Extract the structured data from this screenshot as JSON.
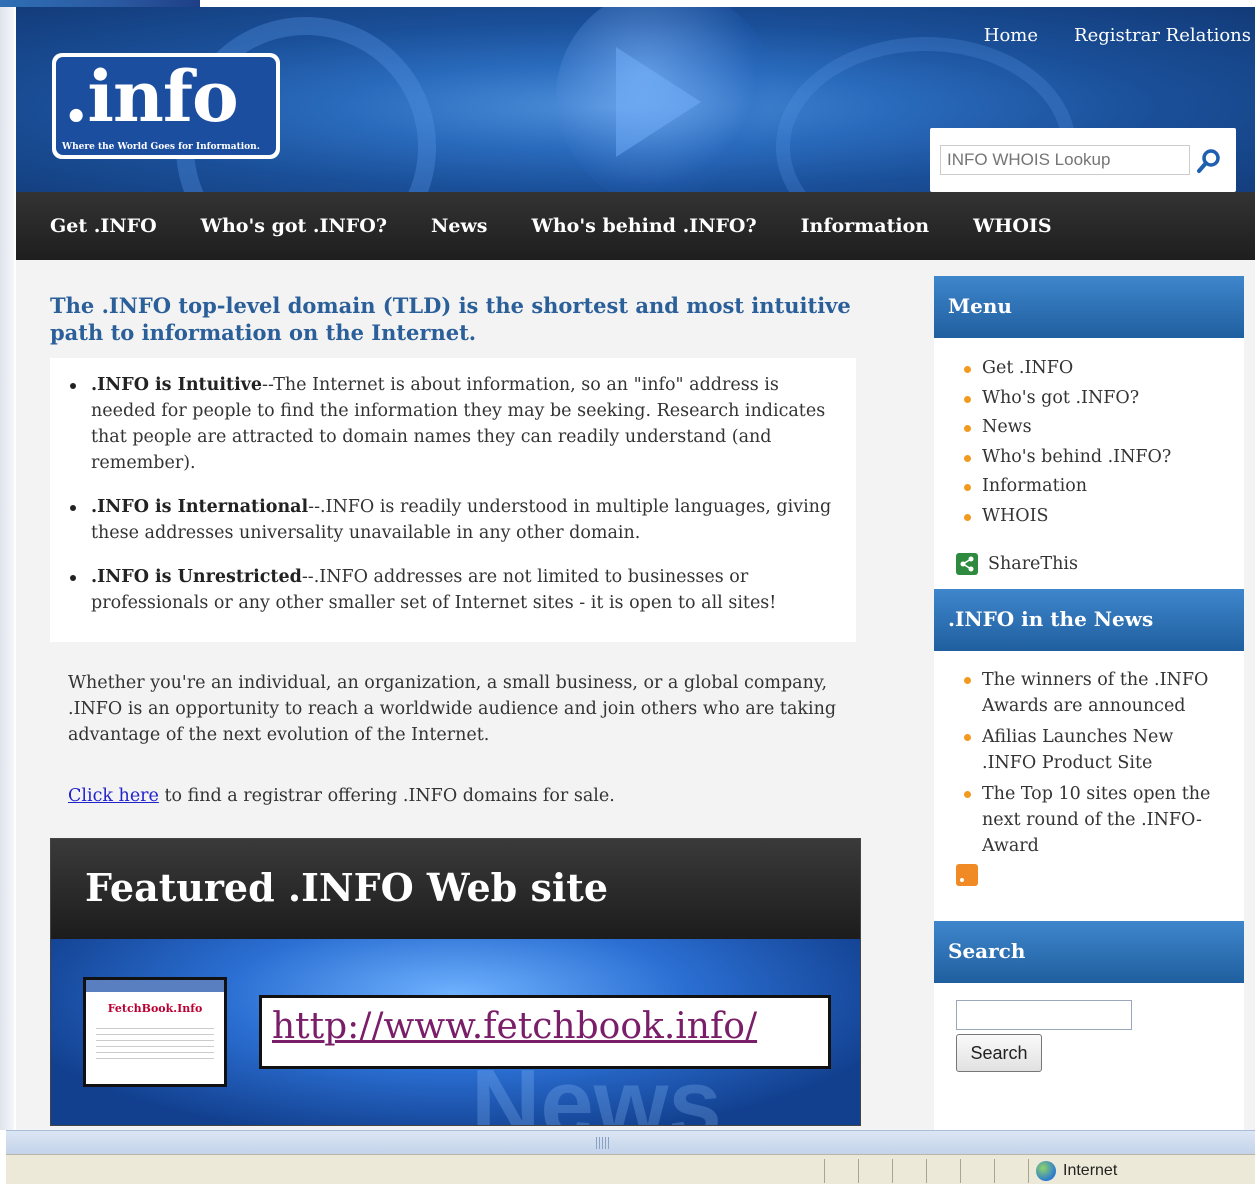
{
  "header": {
    "logo_text": ".info",
    "logo_tagline": "Where the World Goes for Information.",
    "top_links": [
      "Home",
      "Registrar Relations"
    ],
    "whois_placeholder": "INFO WHOIS Lookup"
  },
  "nav": {
    "items": [
      "Get .INFO",
      "Who's got .INFO?",
      "News",
      "Who's behind .INFO?",
      "Information",
      "WHOIS"
    ]
  },
  "main": {
    "intro": "The .INFO top-level domain (TLD) is the shortest and most intuitive path to information on the Internet.",
    "bullets": [
      {
        "title": ".INFO is Intuitive",
        "text": "--The Internet is about information, so an \"info\" address is needed for people to find the information they may be seeking. Research indicates that people are attracted to domain names they can readily understand (and remember)."
      },
      {
        "title": ".INFO is International",
        "text": "--.INFO is readily understood in multiple languages, giving these addresses universality unavailable in any other domain."
      },
      {
        "title": ".INFO is Unrestricted",
        "text": "--.INFO addresses are not limited to businesses or professionals or any other smaller set of Internet sites - it is open to all sites!"
      }
    ],
    "paragraph": "Whether you're an individual, an organization, a small business, or a global company, .INFO is an opportunity to reach a worldwide audience and join others who are taking advantage of the next evolution of the Internet.",
    "click_link": "Click here",
    "click_text": " to find a registrar offering .INFO domains for sale."
  },
  "featured": {
    "heading": "Featured .INFO Web site",
    "thumb_title": "FetchBook.Info",
    "url": "http://www.fetchbook.info/",
    "bg_word": "News"
  },
  "sidebar": {
    "menu_title": "Menu",
    "menu_items": [
      "Get .INFO",
      "Who's got .INFO?",
      "News",
      "Who's behind .INFO?",
      "Information",
      "WHOIS"
    ],
    "share_label": "ShareThis",
    "news_title": ".INFO in the News",
    "news_items": [
      "The winners of the .INFO Awards are announced",
      "Afilias Launches New .INFO Product Site",
      "The Top 10 sites open the next round of the .INFO-Award"
    ],
    "search_title": "Search",
    "search_button": "Search"
  },
  "statusbar": {
    "zone": "Internet"
  },
  "colors": {
    "header_blue": "#1a4f98",
    "nav_dark": "#262626",
    "intro_blue": "#2b5f99",
    "bullet_orange": "#f29a1f",
    "link_blue": "#2222cc",
    "featured_link": "#7a1e6a"
  }
}
